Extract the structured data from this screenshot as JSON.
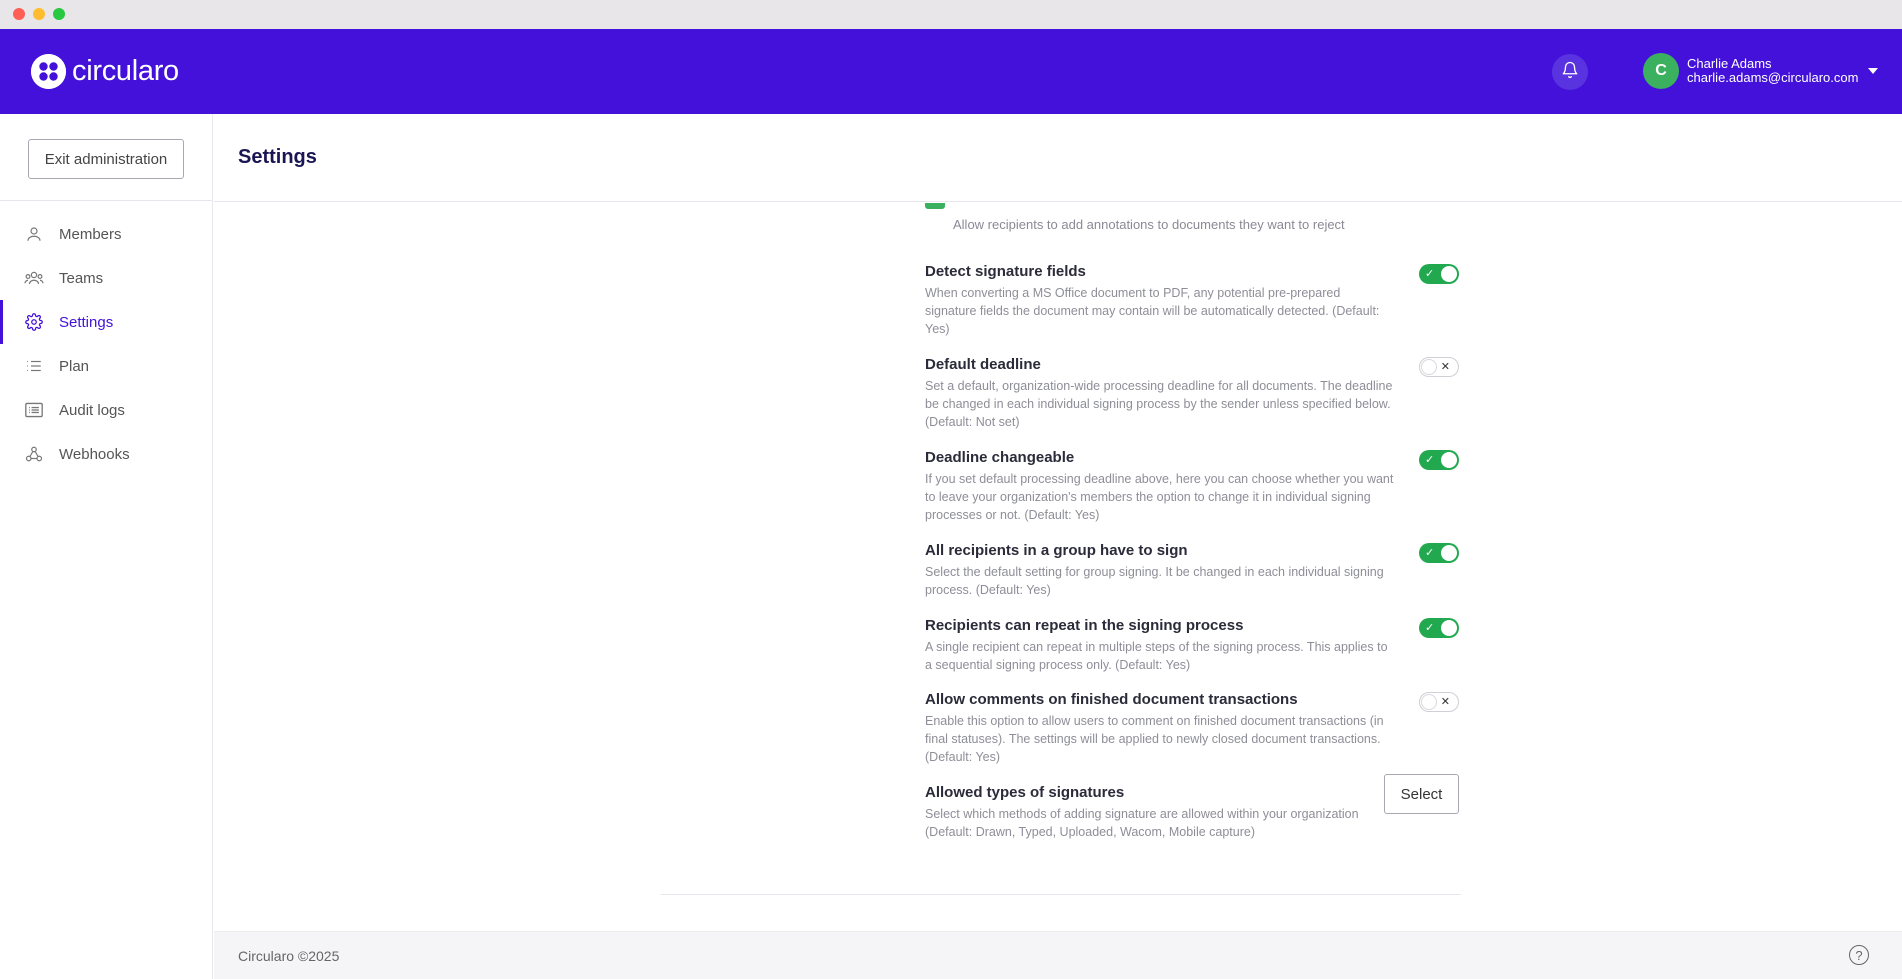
{
  "app": {
    "name": "circularo"
  },
  "header": {
    "user": {
      "initial": "C",
      "name": "Charlie Adams",
      "email": "charlie.adams@circularo.com"
    }
  },
  "sidebar": {
    "exit_label": "Exit administration",
    "items": [
      {
        "label": "Members",
        "icon": "person-icon"
      },
      {
        "label": "Teams",
        "icon": "team-icon"
      },
      {
        "label": "Settings",
        "icon": "gear-icon",
        "active": true
      },
      {
        "label": "Plan",
        "icon": "list-icon"
      },
      {
        "label": "Audit logs",
        "icon": "log-icon"
      },
      {
        "label": "Webhooks",
        "icon": "webhook-icon"
      }
    ]
  },
  "page": {
    "title": "Settings"
  },
  "partial": {
    "desc": "Allow recipients to add annotations to documents they want to reject"
  },
  "settings": [
    {
      "title": "Detect signature fields",
      "desc": "When converting a MS Office document to PDF, any potential pre-prepared signature fields the document may contain will be automatically detected.  (Default: Yes)",
      "enabled": true
    },
    {
      "title": "Default deadline",
      "desc": "Set a default, organization-wide processing deadline for all documents. The deadline be changed in each individual signing process by the sender unless specified below.  (Default: Not set)",
      "enabled": false
    },
    {
      "title": "Deadline changeable",
      "desc": "If you set default processing deadline above, here you can choose whether you want to leave your organization's members the option to change it in individual signing processes or not.  (Default: Yes)",
      "enabled": true
    },
    {
      "title": "All recipients in a group have to sign",
      "desc": "Select the default setting for group signing. It be changed in each individual signing process.  (Default: Yes)",
      "enabled": true
    },
    {
      "title": "Recipients can repeat in the signing process",
      "desc": "A single recipient can repeat in multiple steps of the signing process. This applies to a sequential signing process only.  (Default: Yes)",
      "enabled": true
    },
    {
      "title": "Allow comments on finished document transactions",
      "desc": "Enable this option to allow users to comment on finished document transactions (in final statuses). The settings will be applied to newly closed document transactions.  (Default: Yes)",
      "enabled": false
    },
    {
      "title": "Allowed types of signatures",
      "desc": "Select which methods of adding signature are allowed within your organization  (Default: Drawn, Typed, Uploaded, Wacom, Mobile capture)",
      "button": "Select"
    }
  ],
  "footer": {
    "text": "Circularo ©2025",
    "help": "?"
  },
  "colors": {
    "brand": "#4311d9",
    "toggle_on": "#22a950"
  }
}
